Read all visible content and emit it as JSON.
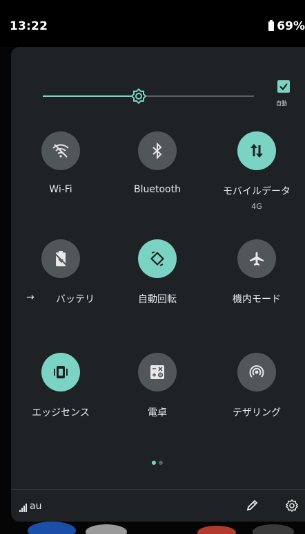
{
  "status_bar": {
    "time": "13:22",
    "battery": "69%"
  },
  "brightness": {
    "level": 0.46,
    "auto_label": "自動",
    "auto_checked": true
  },
  "tiles": [
    {
      "label": "Wi-Fi",
      "icon": "wifi-off-icon",
      "active": false
    },
    {
      "label": "Bluetooth",
      "icon": "bluetooth-icon",
      "active": false
    },
    {
      "label": "モバイルデータ",
      "sublabel": "4G",
      "icon": "mobile-data-icon",
      "active": true
    },
    {
      "label": "バッテリ",
      "prefix": "→",
      "icon": "battery-saver-icon",
      "active": false
    },
    {
      "label": "自動回転",
      "icon": "auto-rotate-icon",
      "active": true
    },
    {
      "label": "機内モード",
      "icon": "airplane-icon",
      "active": false
    },
    {
      "label": "エッジセンス",
      "icon": "edge-sense-icon",
      "active": true
    },
    {
      "label": "電卓",
      "icon": "calculator-icon",
      "active": false
    },
    {
      "label": "テザリング",
      "icon": "hotspot-icon",
      "active": false
    }
  ],
  "pager": {
    "pages": 2,
    "current": 1
  },
  "footer": {
    "carrier": "au",
    "edit_icon": "pencil-icon",
    "settings_icon": "gear-icon"
  },
  "colors": {
    "accent": "#7bd3c4",
    "panel": "#1f2224",
    "tile_off": "#515658"
  }
}
